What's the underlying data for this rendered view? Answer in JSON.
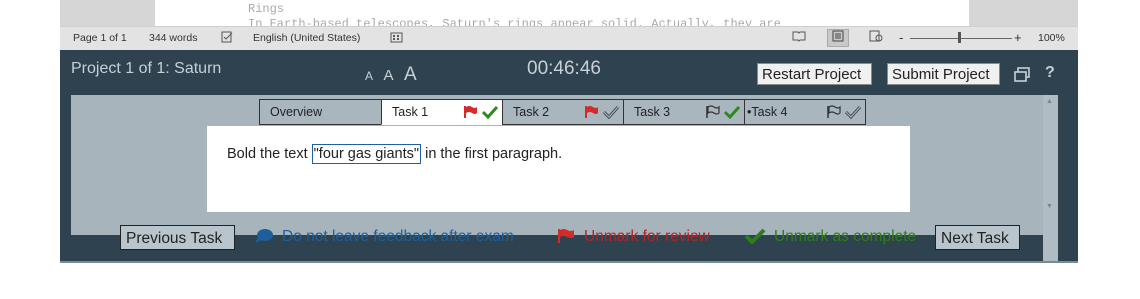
{
  "document": {
    "line1": "Rings",
    "line2": "In Earth-based telescopes, Saturn's rings appear solid. Actually, they are"
  },
  "statusbar": {
    "page": "Page 1 of 1",
    "words": "344 words",
    "language": "English (United States)",
    "zoom_percent": "100%",
    "zoom_minus": "-",
    "zoom_plus": "+"
  },
  "exam": {
    "project_title": "Project 1 of 1: Saturn",
    "font_small": "A",
    "font_medium": "A",
    "font_large": "A",
    "timer": "00:46:46",
    "restart_label": "Restart Project",
    "submit_label": "Submit Project",
    "help_label": "?"
  },
  "tabs": [
    {
      "label": "Overview",
      "active": false
    },
    {
      "label": "Task 1",
      "active": true,
      "flag": "red",
      "check": "green"
    },
    {
      "label": "Task 2",
      "active": false,
      "flag": "red",
      "check": "outline"
    },
    {
      "label": "Task 3",
      "active": false,
      "flag": "outline",
      "check": "green"
    },
    {
      "label": "•Task 4",
      "active": false,
      "flag": "outline",
      "check": "outline"
    }
  ],
  "task": {
    "instruction_before": "Bold the text ",
    "instruction_highlight": "\"four gas giants\"",
    "instruction_after": " in the first paragraph."
  },
  "bottom": {
    "previous_label": "Previous Task",
    "feedback_label": "Do not leave feedback after exam",
    "review_label": "Unmark for review",
    "complete_label": "Unmark as complete",
    "next_label": "Next Task"
  },
  "colors": {
    "panel": "#2e434f",
    "task_area": "#a7b4bc",
    "flag_red": "#d42a2a",
    "check_green": "#2d8a1e",
    "link_blue": "#1c5f9b"
  }
}
